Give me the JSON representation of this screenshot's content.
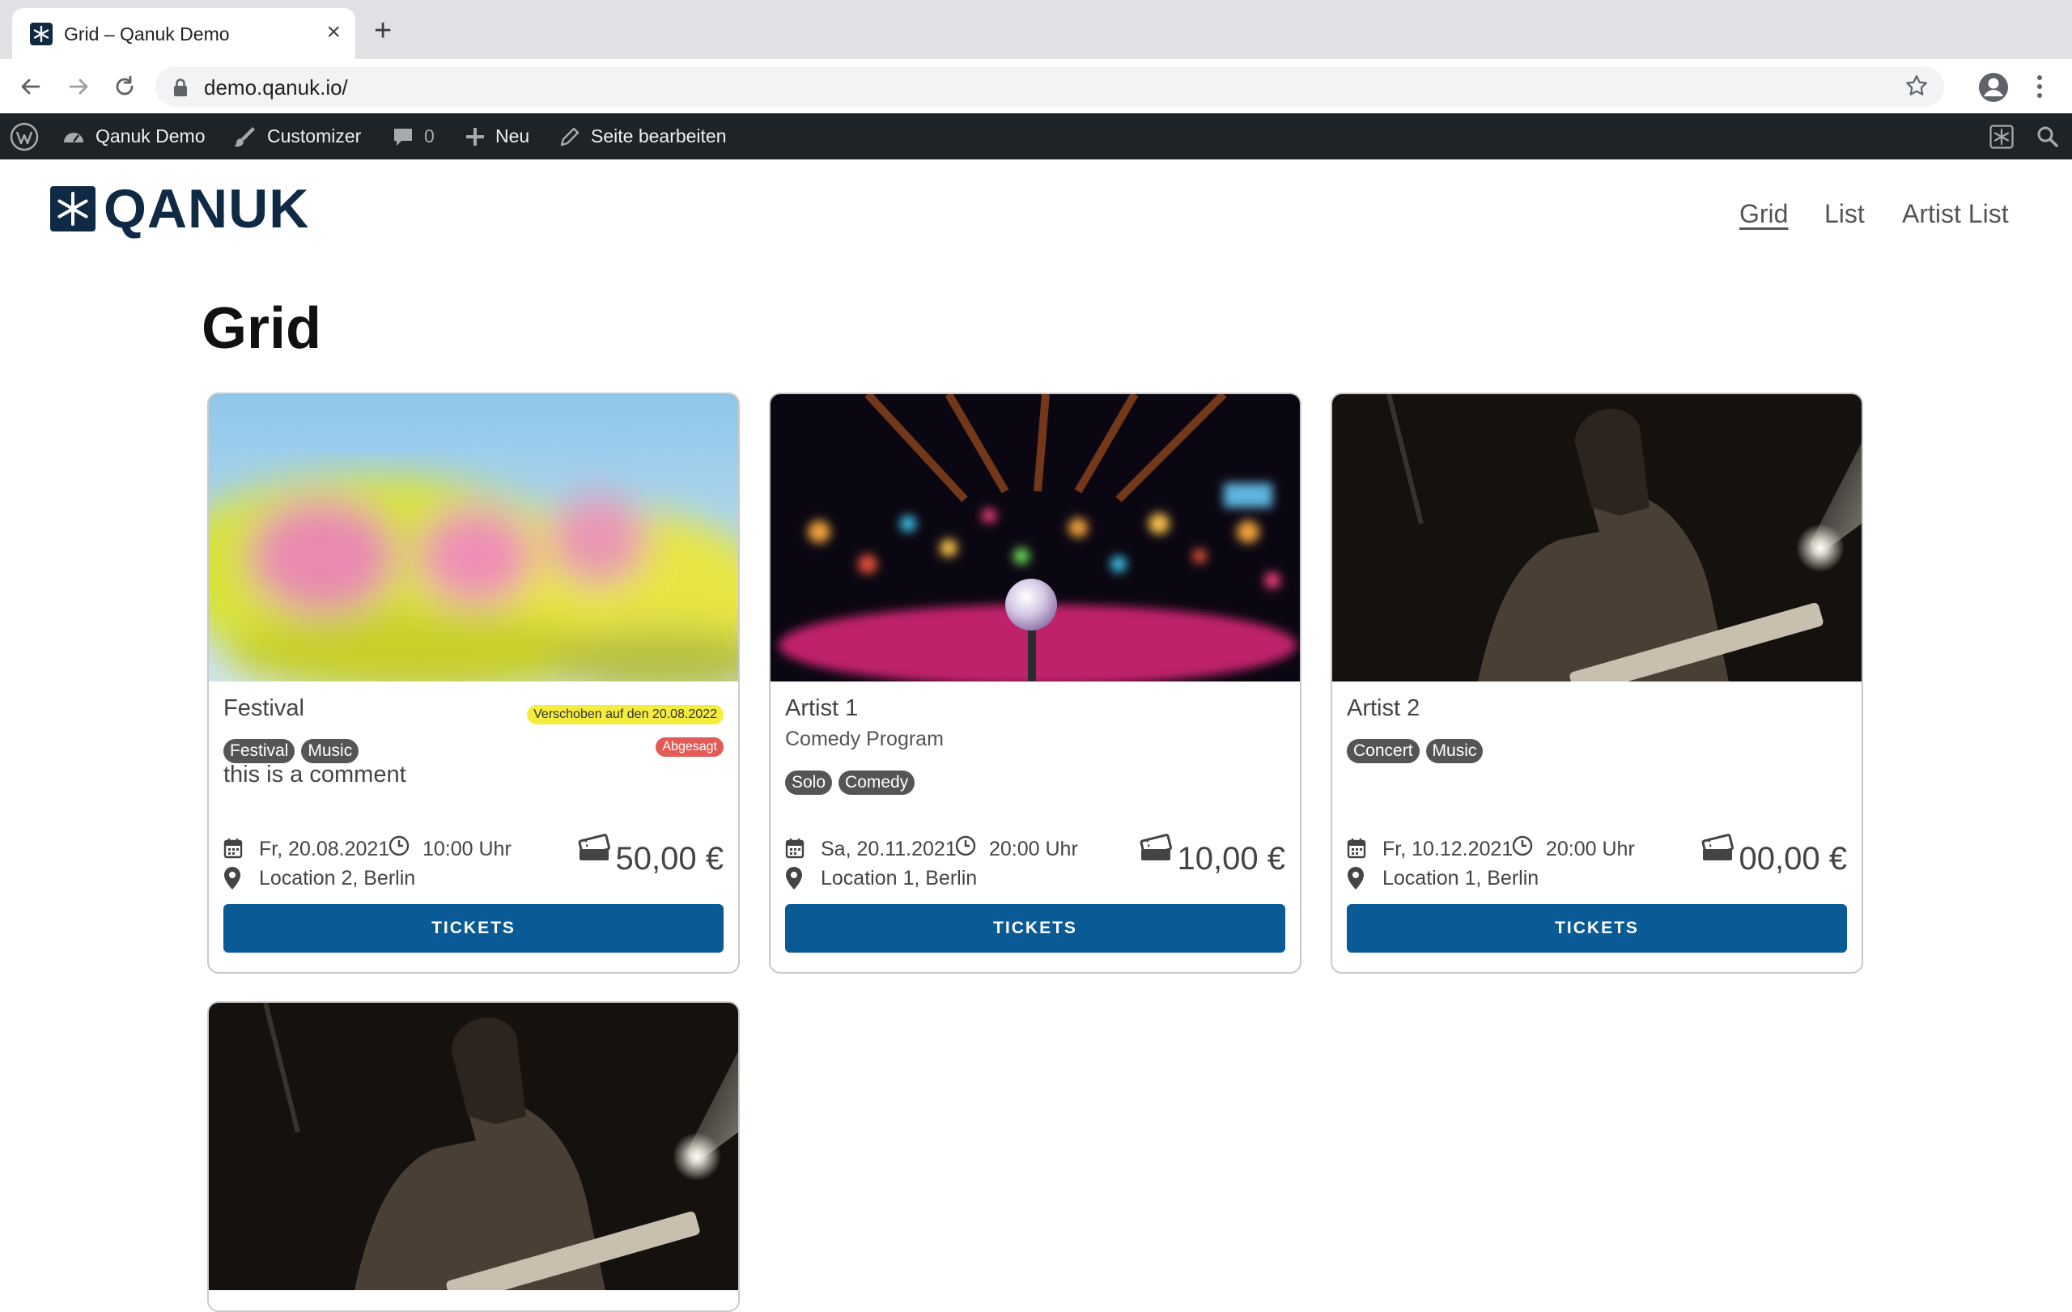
{
  "browser": {
    "tab_title": "Grid – Qanuk Demo",
    "url": "demo.qanuk.io/"
  },
  "adminbar": {
    "site": "Qanuk Demo",
    "customizer": "Customizer",
    "comments": "0",
    "new": "Neu",
    "edit": "Seite bearbeiten"
  },
  "site": {
    "logo": "QANUK",
    "nav": [
      {
        "label": "Grid",
        "active": true
      },
      {
        "label": "List",
        "active": false
      },
      {
        "label": "Artist List",
        "active": false
      }
    ]
  },
  "page": {
    "title": "Grid"
  },
  "events": [
    {
      "title": "Festival",
      "subtitle": "",
      "tags": [
        "Festival",
        "Music"
      ],
      "comment": "this is a comment",
      "status_postponed": "Verschoben auf den 20.08.2022",
      "status_cancelled": "Abgesagt",
      "date": "Fr, 20.08.2021",
      "time": "10:00 Uhr",
      "location": "Location 2, Berlin",
      "price": "50,00 €",
      "cta": "TICKETS",
      "image": "color-powder-festival-photo"
    },
    {
      "title": "Artist 1",
      "subtitle": "Comedy Program",
      "tags": [
        "Solo",
        "Comedy"
      ],
      "comment": "",
      "date": "Sa, 20.11.2021",
      "time": "20:00 Uhr",
      "location": "Location 1, Berlin",
      "price": "10,00 €",
      "cta": "TICKETS",
      "image": "club-stage-microphone-photo"
    },
    {
      "title": "Artist 2",
      "subtitle": "",
      "tags": [
        "Concert",
        "Music"
      ],
      "comment": "",
      "date": "Fr, 10.12.2021",
      "time": "20:00 Uhr",
      "location": "Location 1, Berlin",
      "price": "00,00 €",
      "cta": "TICKETS",
      "image": "guitarist-sepia-photo"
    },
    {
      "image": "guitarist-sepia-photo"
    }
  ],
  "colors": {
    "button": "#0a5a96",
    "adminbar": "#1d2327",
    "tag": "#555555",
    "badge_postponed": "#f5ec3d",
    "badge_cancelled": "#e25b56",
    "logo": "#0f2a44"
  }
}
